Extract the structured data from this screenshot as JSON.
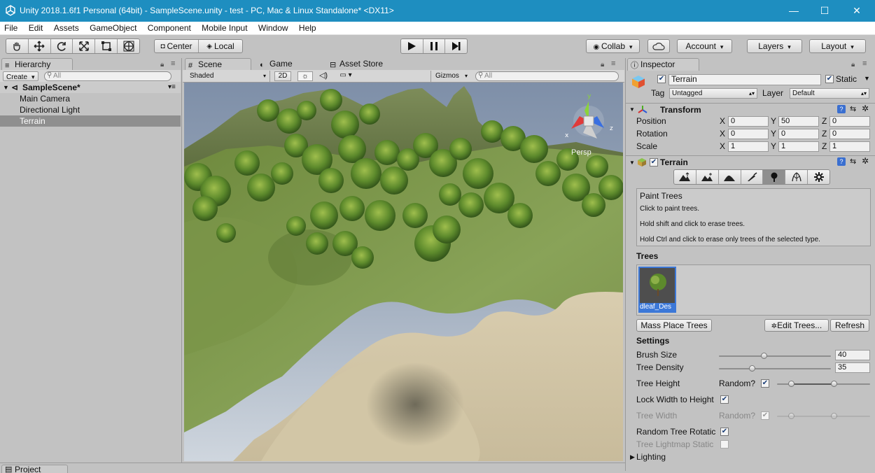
{
  "window": {
    "title": "Unity 2018.1.6f1 Personal (64bit) - SampleScene.unity - test - PC, Mac & Linux Standalone* <DX11>"
  },
  "menu": [
    "File",
    "Edit",
    "Assets",
    "GameObject",
    "Component",
    "Mobile Input",
    "Window",
    "Help"
  ],
  "toolbar": {
    "pivot": "Center",
    "space": "Local",
    "collab": "Collab",
    "account": "Account",
    "layers": "Layers",
    "layout": "Layout"
  },
  "hierarchy": {
    "tab": "Hierarchy",
    "create": "Create",
    "search_placeholder": "All",
    "scene": "SampleScene*",
    "items": [
      "Main Camera",
      "Directional Light",
      "Terrain"
    ],
    "selected_index": 2
  },
  "scene_view": {
    "tabs": [
      "Scene",
      "Game",
      "Asset Store"
    ],
    "shading": "Shaded",
    "mode_2d": "2D",
    "gizmos": "Gizmos",
    "search_placeholder": "All",
    "gizmo_axes": {
      "x": "x",
      "y": "y",
      "z": "z"
    },
    "projection": "Persp"
  },
  "inspector": {
    "tab": "Inspector",
    "object_name": "Terrain",
    "static_label": "Static",
    "tag_label": "Tag",
    "tag_value": "Untagged",
    "layer_label": "Layer",
    "layer_value": "Default",
    "transform": {
      "title": "Transform",
      "rows": [
        {
          "label": "Position",
          "x": "0",
          "y": "50",
          "z": "0"
        },
        {
          "label": "Rotation",
          "x": "0",
          "y": "0",
          "z": "0"
        },
        {
          "label": "Scale",
          "x": "1",
          "y": "1",
          "z": "1"
        }
      ],
      "axis": {
        "x": "X",
        "y": "Y",
        "z": "Z"
      }
    },
    "terrain": {
      "title": "Terrain",
      "tools": [
        "raise-lower-icon",
        "paint-height-icon",
        "smooth-height-icon",
        "paint-texture-icon",
        "place-trees-icon",
        "paint-details-icon",
        "terrain-settings-icon"
      ],
      "active_tool": 4,
      "help_title": "Paint Trees",
      "help_lines": [
        "Click to paint trees.",
        "Hold shift and click to erase trees.",
        "Hold Ctrl and click to erase only trees of the selected type."
      ],
      "trees_header": "Trees",
      "tree_prototype": "dleaf_Des",
      "mass_place": "Mass Place Trees",
      "edit_trees": "Edit Trees...",
      "refresh": "Refresh",
      "settings_header": "Settings",
      "brush_size_label": "Brush Size",
      "brush_size": "40",
      "brush_size_frac": 0.4,
      "tree_density_label": "Tree Density",
      "tree_density": "35",
      "tree_density_frac": 0.3,
      "tree_height_label": "Tree Height",
      "random_label": "Random?",
      "lock_width_label": "Lock Width to Height",
      "tree_width_label": "Tree Width",
      "random_rotation_label": "Random Tree Rotatic",
      "lightmap_static_label": "Tree Lightmap Static",
      "lighting_label": "Lighting"
    }
  },
  "bottom": {
    "project_tab": "Project"
  },
  "colors": {
    "titlebar": "#1e8ec0",
    "selection": "#8f8f8f",
    "panel": "#c2c2c2",
    "accent": "#3c78d8"
  }
}
